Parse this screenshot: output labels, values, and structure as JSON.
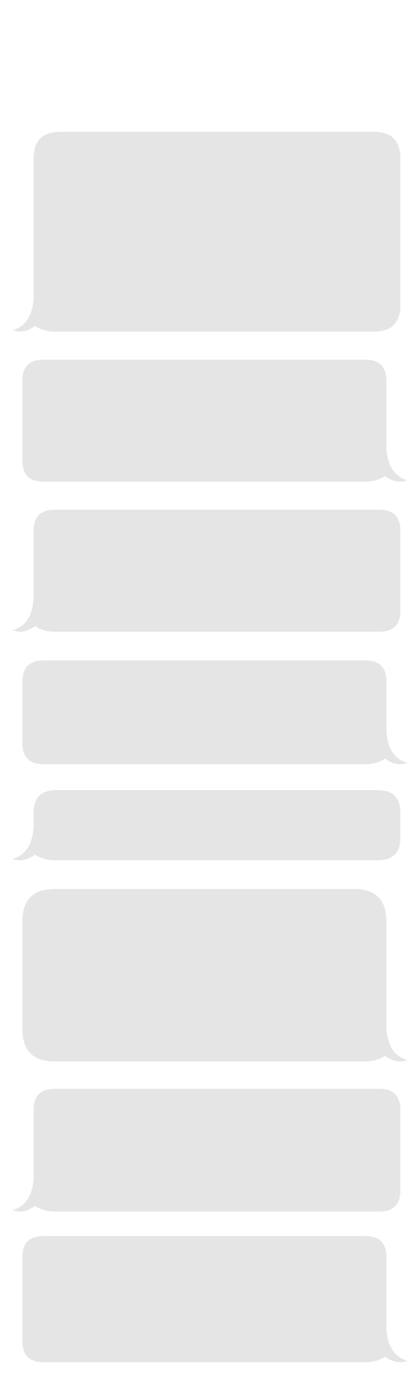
{
  "conversation": {
    "bubble_color": "#e5e5e5",
    "background_color": "#ffffff",
    "messages": [
      {
        "side": "left",
        "text": ""
      },
      {
        "side": "right",
        "text": ""
      },
      {
        "side": "left",
        "text": ""
      },
      {
        "side": "right",
        "text": ""
      },
      {
        "side": "left",
        "text": ""
      },
      {
        "side": "right",
        "text": ""
      },
      {
        "side": "left",
        "text": ""
      },
      {
        "side": "right",
        "text": ""
      }
    ]
  }
}
